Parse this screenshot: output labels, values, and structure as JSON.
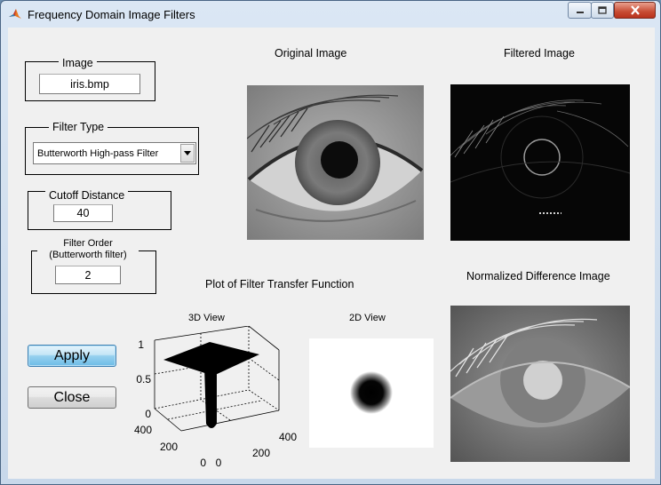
{
  "window": {
    "title": "Frequency Domain Image Filters"
  },
  "image_panel": {
    "title": "Image",
    "value": "iris.bmp"
  },
  "filter_type_panel": {
    "title": "Filter Type",
    "selected": "Butterworth High-pass Filter"
  },
  "cutoff_panel": {
    "title": "Cutoff Distance",
    "value": "40"
  },
  "order_panel": {
    "title_line1": "Filter Order",
    "title_line2": "(Butterworth filter)",
    "value": "2"
  },
  "buttons": {
    "apply": "Apply",
    "close": "Close"
  },
  "titles": {
    "original": "Original Image",
    "filtered": "Filtered Image",
    "transfer": "Plot of Filter Transfer Function",
    "view3d": "3D View",
    "view2d": "2D View",
    "difference": "Normalized Difference Image"
  },
  "plot3d": {
    "z_ticks": [
      "1",
      "0.5",
      "0"
    ],
    "y_ticks": [
      "400",
      "200",
      "0"
    ],
    "x_ticks": [
      "0",
      "200",
      "400"
    ]
  },
  "icons": {
    "app": "matlab-icon",
    "minimize": "minimize-icon",
    "maximize": "maximize-icon",
    "close": "close-icon",
    "dropdown": "dropdown-arrow-icon"
  }
}
